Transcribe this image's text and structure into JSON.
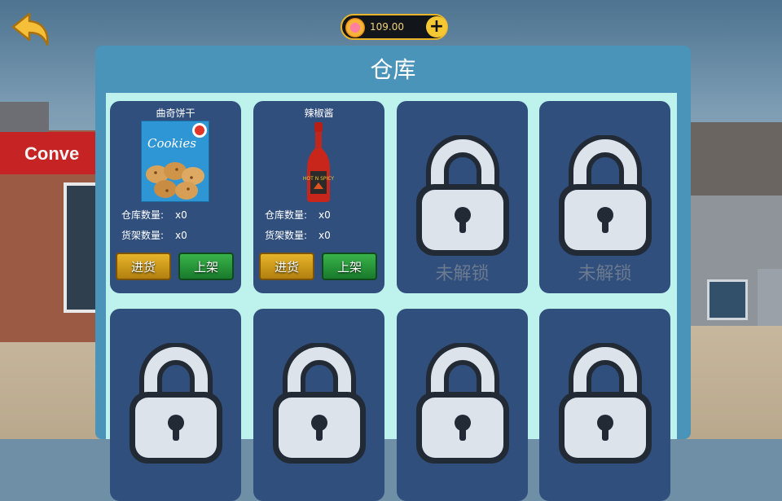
{
  "currency": {
    "amount": "109.00",
    "plus_label": "+"
  },
  "store_sign": "Conve",
  "panel": {
    "title": "仓库"
  },
  "products": [
    {
      "name": "曲奇饼干",
      "image_text": "Cookies",
      "icon": "cookies-box-image",
      "stock_label": "仓库数量:",
      "stock_value": "x0",
      "shelf_label": "货架数量:",
      "shelf_value": "x0",
      "restock_label": "进货",
      "shelve_label": "上架"
    },
    {
      "name": "辣椒酱",
      "image_text": "HOT N SPICY",
      "icon": "hot-sauce-bottle-image",
      "stock_label": "仓库数量:",
      "stock_value": "x0",
      "shelf_label": "货架数量:",
      "shelf_value": "x0",
      "restock_label": "进货",
      "shelve_label": "上架"
    }
  ],
  "locked": {
    "label": "未解锁",
    "icon": "lock-icon"
  },
  "colors": {
    "panel": "#4a93b9",
    "grid_bg": "#bdf3ec",
    "card": "#314f7d",
    "restock_button": "#e7b52a",
    "shelve_button": "#39b34a",
    "locked_text": "#6b7a8f"
  }
}
